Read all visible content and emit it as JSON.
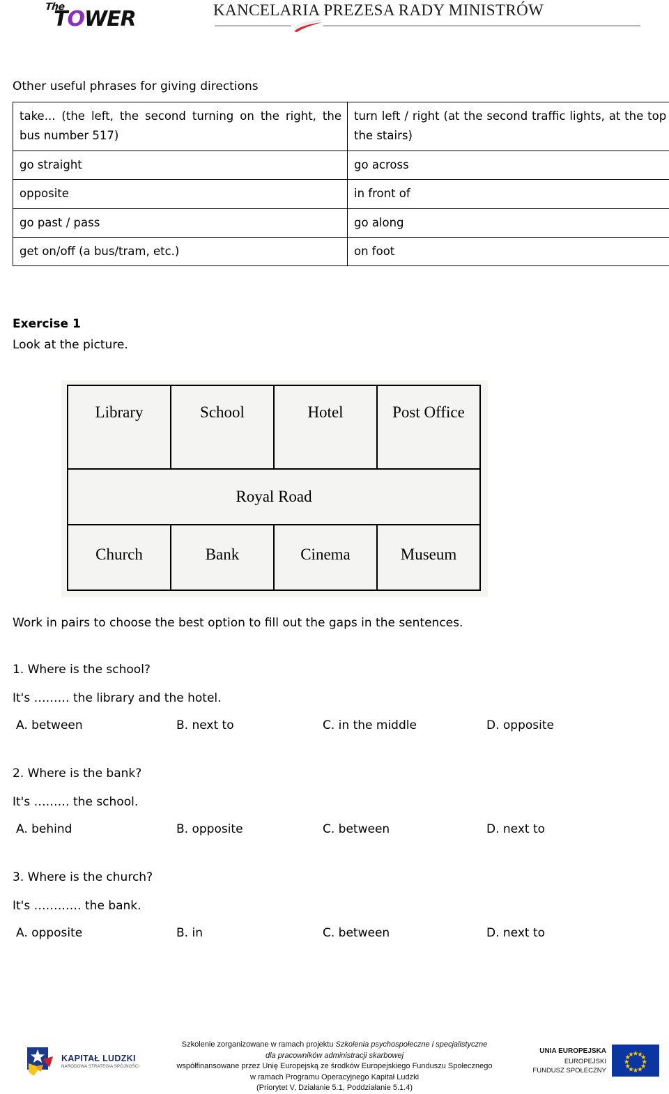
{
  "header": {
    "brand_the": "The",
    "brand_t": "T",
    "brand_o": "O",
    "brand_wer": "WER",
    "institution": "KANCELARIA PREZESA RADY MINISTRÓW",
    "flag_icon": "polish-flag-icon"
  },
  "phrases": {
    "title": "Other useful phrases for giving directions",
    "rows": [
      {
        "left": "take... (the left, the second turning on the right, the bus number 517)",
        "right": "turn left / right (at the second traffic lights, at the top of the stairs)"
      },
      {
        "left": "go straight",
        "right": "go across"
      },
      {
        "left": "opposite",
        "right": "in front of"
      },
      {
        "left": "go past / pass",
        "right": "go along"
      },
      {
        "left": "get on/off (a bus/tram, etc.)",
        "right": "on foot"
      }
    ]
  },
  "exercise": {
    "heading": "Exercise 1",
    "instruction": "Look at the picture.",
    "pairs_instruction": "Work in pairs to choose the best option to fill out the gaps in the sentences."
  },
  "map": {
    "top_row": [
      "Library",
      "School",
      "Hotel",
      "Post\nOffice"
    ],
    "top_row_labels": {
      "0": "Library",
      "1": "School",
      "2": "Hotel",
      "3": "Post Office"
    },
    "road": "Royal Road",
    "bottom_row": [
      "Church",
      "Bank",
      "Cinema",
      "Museum"
    ]
  },
  "questions": [
    {
      "prompt": "1. Where is the school?",
      "sentence": "It's ……… the library and the hotel.",
      "options": {
        "a": "A. between",
        "b": "B. next to",
        "c": "C. in the middle",
        "d": "D. opposite"
      }
    },
    {
      "prompt": "2. Where is the bank?",
      "sentence": "It's ……… the school.",
      "options": {
        "a": "A. behind",
        "b": "B. opposite",
        "c": "C. between",
        "d": "D. next to"
      }
    },
    {
      "prompt": "3. Where is the church?",
      "sentence": "It's ………… the bank.",
      "options": {
        "a": "A. opposite",
        "b": "B. in",
        "c": "C. between",
        "d": "D. next to"
      }
    }
  ],
  "footer": {
    "kapital_ludzki_title": "KAPITAŁ LUDZKI",
    "kapital_ludzki_sub": "NARODOWA STRATEGIA SPÓJNOŚCI",
    "line1_plain": "Szkolenie zorganizowane w ramach projektu ",
    "line1_italic": "Szkolenia psychospołeczne i specjalistyczne",
    "line2_italic": "dla pracowników administracji skarbowej",
    "line3": "współfinansowane przez Unię Europejską ze środków Europejskiego Funduszu Społecznego",
    "line4": "w ramach Programu Operacyjnego Kapitał Ludzki",
    "line5": "(Priorytet V, Działanie 5.1, Poddziałanie 5.1.4)",
    "eu_line1": "UNIA EUROPEJSKA",
    "eu_line2": "EUROPEJSKI",
    "eu_line3": "FUNDUSZ SPOŁECZNY",
    "eu_flag_icon": "eu-flag-icon"
  },
  "colors": {
    "logo_accent": "#8B2FBE",
    "eu_blue": "#0b35a0",
    "eu_star_yellow": "#ffcc00",
    "kl_navy": "#1b2a5e",
    "flag_red": "#d7252e"
  }
}
